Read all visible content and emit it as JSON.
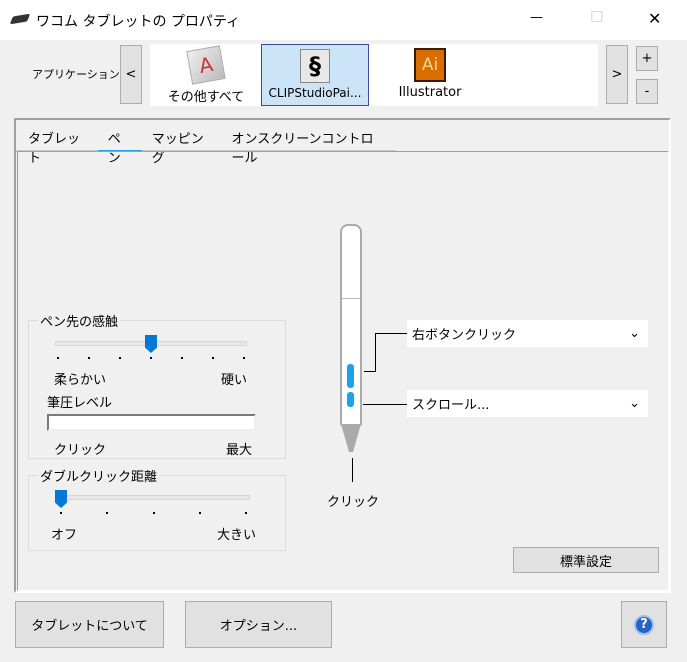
{
  "window": {
    "title": "ワコム タブレットの プロパティ",
    "minimize": "—",
    "maximize": "☐",
    "close": "✕"
  },
  "apps": {
    "label": "アプリケーション:",
    "prev": "<",
    "next": ">",
    "add": "+",
    "remove": "-",
    "items": [
      {
        "label": "その他すべて",
        "icon": "all-apps-icon"
      },
      {
        "label": "CLIPStudioPai...",
        "icon": "clip-studio-icon",
        "selected": true
      },
      {
        "label": "Illustrator",
        "icon": "illustrator-icon",
        "glyph": "Ai"
      }
    ]
  },
  "tabs": [
    {
      "label": "タブレット"
    },
    {
      "label": "ペン",
      "active": true
    },
    {
      "label": "マッピング"
    },
    {
      "label": "オンスクリーンコントロール"
    }
  ],
  "tip_feel": {
    "title": "ペン先の感触",
    "min_label": "柔らかい",
    "max_label": "硬い",
    "ticks": 7,
    "value_index": 3,
    "pressure_label": "筆圧レベル",
    "click_label": "クリック",
    "max_pressure_label": "最大",
    "pressure_level": 0
  },
  "double_click": {
    "title": "ダブルクリック距離",
    "min_label": "オフ",
    "max_label": "大きい",
    "ticks": 5,
    "value_index": 0
  },
  "pen": {
    "upper_button": "右ボタンクリック",
    "lower_button": "スクロール...",
    "tip_label": "クリック"
  },
  "default_button": "標準設定",
  "footer": {
    "about": "タブレットについて",
    "options": "オプション...",
    "help": "?"
  },
  "colors": {
    "accent": "#0078d7",
    "pen_button": "#1aa3e8"
  }
}
